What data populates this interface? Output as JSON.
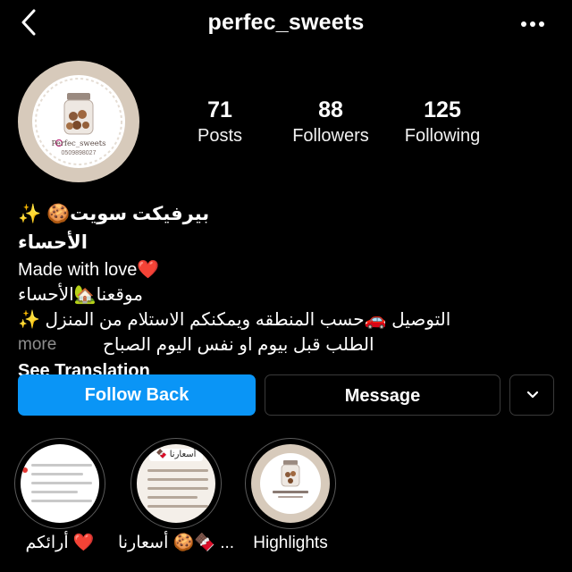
{
  "header": {
    "username": "perfec_sweets",
    "back_icon": "chevron-left-icon",
    "more_icon": "more-horizontal-icon"
  },
  "avatar": {
    "handle_text": "Perfec_sweets",
    "phone_text": "0509898027"
  },
  "stats": [
    {
      "value": "71",
      "label": "Posts"
    },
    {
      "value": "88",
      "label": "Followers"
    },
    {
      "value": "125",
      "label": "Following"
    }
  ],
  "bio": {
    "name": "بيرفيكت سويت🍪 ✨ الأحساء",
    "line1": "Made with love❤️",
    "line2": "موقعنا🏡الأحساء",
    "line3": "التوصيل 🚗حسب المنطقه ويمكنكم الاستلام من المنزل ✨",
    "line4": "الطلب قبل بيوم او نفس اليوم الصباح",
    "more_label": "more",
    "see_translation": "See Translation"
  },
  "actions": {
    "follow_back": "Follow Back",
    "message": "Message"
  },
  "highlights": [
    {
      "label": "أرائكم ❤️"
    },
    {
      "label": "أسعارنا 🍪🍫 ...",
      "badge": "أسعارنا 🍫"
    },
    {
      "label": "Highlights"
    }
  ],
  "colors": {
    "background": "#000000",
    "primary_button": "#0a95f6",
    "secondary_text": "#8e8e8e",
    "avatar_ring": "#d7cabb"
  }
}
